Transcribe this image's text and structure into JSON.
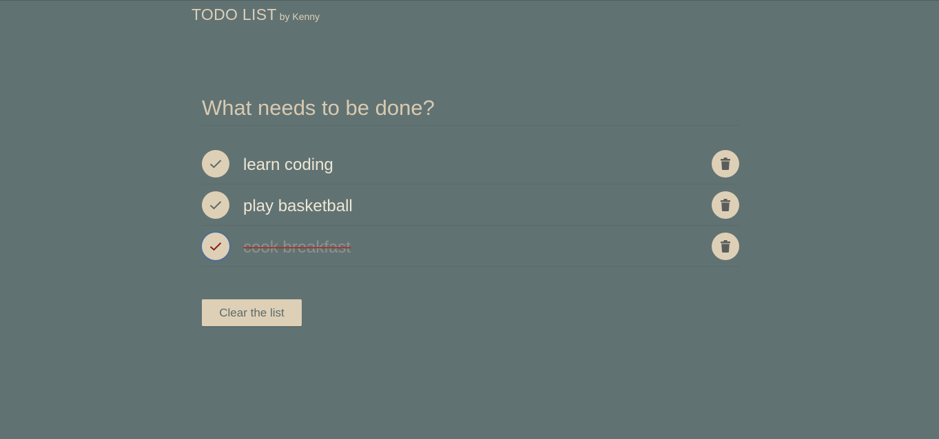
{
  "header": {
    "title": "TODO LIST",
    "byline": "by Kenny"
  },
  "input": {
    "placeholder": "What needs to be done?",
    "value": ""
  },
  "todos": [
    {
      "text": "learn coding",
      "done": false
    },
    {
      "text": "play basketball",
      "done": false
    },
    {
      "text": "cook breakfast",
      "done": true
    }
  ],
  "actions": {
    "clear_label": "Clear the list"
  },
  "icons": {
    "check": "check-icon",
    "delete": "trash-icon"
  },
  "colors": {
    "background": "#617273",
    "accent": "#ded0b6",
    "check_default": "#5e6a6a",
    "check_done": "#8b1d12",
    "strike": "#9e3b2e"
  }
}
